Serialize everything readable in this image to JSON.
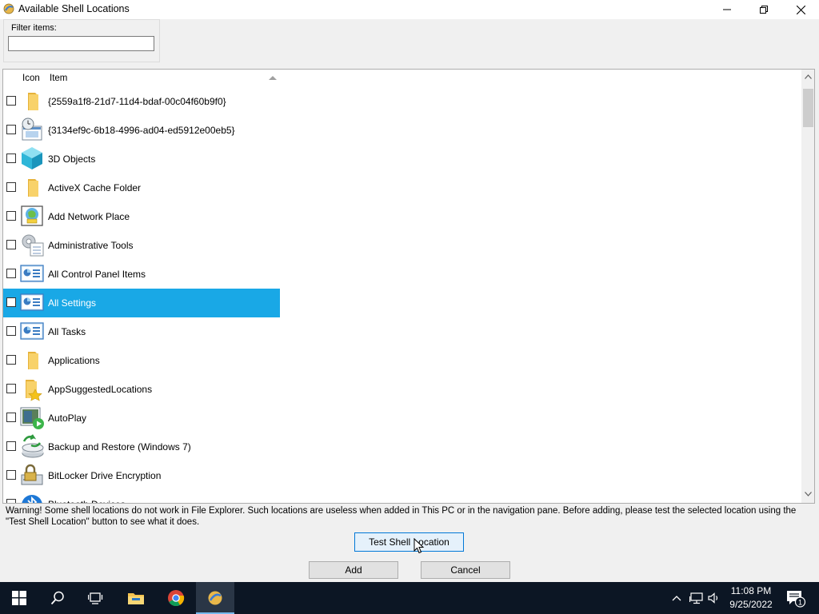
{
  "window": {
    "title": "Available Shell Locations",
    "icon": "shell-app-icon"
  },
  "filter": {
    "label": "Filter items:",
    "value": "",
    "placeholder": ""
  },
  "list": {
    "columns": [
      "Icon",
      "Item"
    ],
    "sort_column": "Item",
    "sort_direction": "ascending",
    "selected_index": 7,
    "items": [
      {
        "label": "{2559a1f8-21d7-11d4-bdaf-00c04f60b9f0}",
        "icon": "folder-icon",
        "checked": false
      },
      {
        "label": "{3134ef9c-6b18-4996-ad04-ed5912e00eb5}",
        "icon": "clock-window-icon",
        "checked": false
      },
      {
        "label": "3D Objects",
        "icon": "cube-icon",
        "checked": false
      },
      {
        "label": "ActiveX Cache Folder",
        "icon": "folder-icon",
        "checked": false
      },
      {
        "label": "Add Network Place",
        "icon": "network-place-icon",
        "checked": false
      },
      {
        "label": "Administrative Tools",
        "icon": "admin-tools-icon",
        "checked": false
      },
      {
        "label": "All Control Panel Items",
        "icon": "control-panel-icon",
        "checked": false
      },
      {
        "label": "All Settings",
        "icon": "control-panel-icon",
        "checked": false
      },
      {
        "label": "All Tasks",
        "icon": "control-panel-icon",
        "checked": false
      },
      {
        "label": "Applications",
        "icon": "folder-icon",
        "checked": false
      },
      {
        "label": "AppSuggestedLocations",
        "icon": "star-folder-icon",
        "checked": false
      },
      {
        "label": "AutoPlay",
        "icon": "autoplay-icon",
        "checked": false
      },
      {
        "label": "Backup and Restore (Windows 7)",
        "icon": "backup-icon",
        "checked": false
      },
      {
        "label": "BitLocker Drive Encryption",
        "icon": "bitlocker-icon",
        "checked": false
      },
      {
        "label": "Bluetooth Devices",
        "icon": "bluetooth-icon",
        "checked": false
      }
    ]
  },
  "warning": "Warning! Some shell locations do not work in File Explorer. Such locations are useless when added in This PC or in the navigation pane. Before adding, please test the selected location using the \"Test Shell Location\" button to see what it does.",
  "buttons": {
    "test": "Test Shell Location",
    "add": "Add",
    "cancel": "Cancel"
  },
  "taskbar": {
    "items": [
      "start-icon",
      "search-icon",
      "task-view-icon",
      "file-explorer-icon",
      "chrome-icon",
      "winaero-tweaker-icon"
    ],
    "active": "winaero-tweaker-icon",
    "time": "11:08 PM",
    "date": "9/25/2022",
    "notification_count": "1"
  },
  "colors": {
    "selection": "#19a8e6",
    "taskbar": "#0c1624",
    "button_focus_border": "#0078d7"
  }
}
